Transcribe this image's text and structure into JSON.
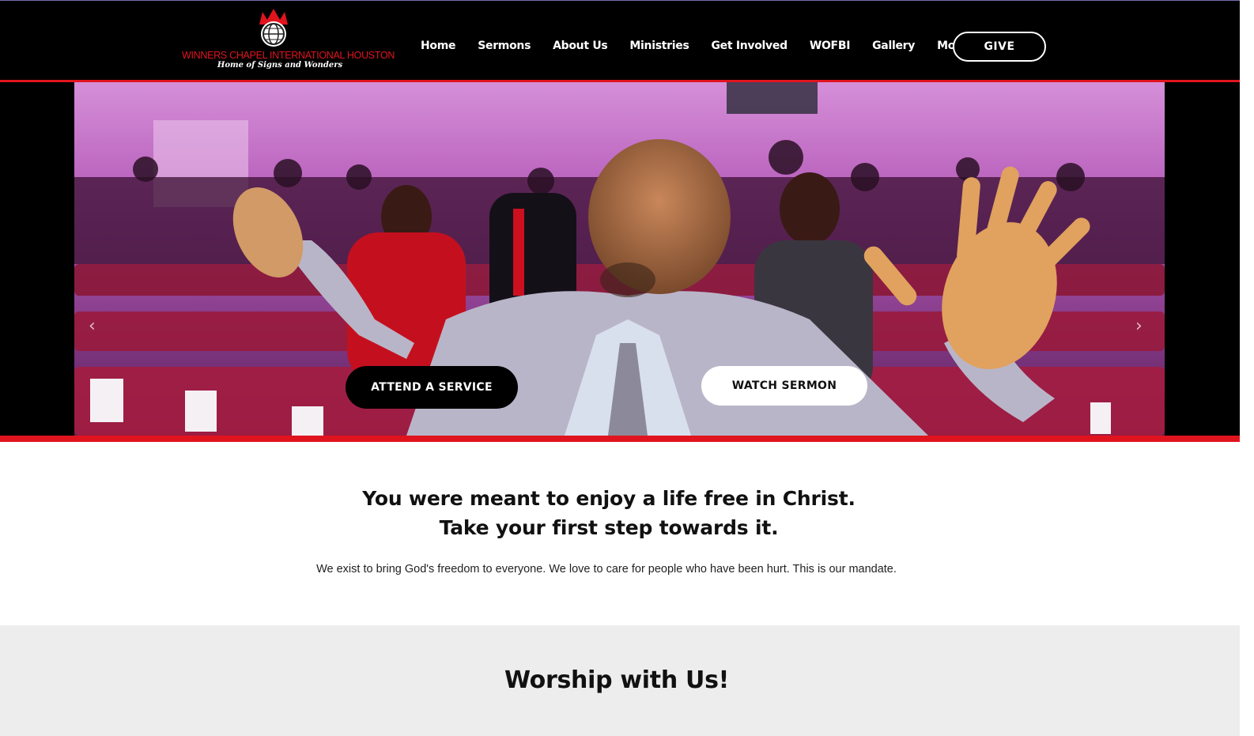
{
  "header": {
    "logo": {
      "name": "WINNERS CHAPEL INTERNATIONAL HOUSTON",
      "tagline": "Home of Signs and Wonders"
    },
    "nav": [
      "Home",
      "Sermons",
      "About Us",
      "Ministries",
      "Get Involved",
      "WOFBI",
      "Gallery",
      "More"
    ],
    "give_label": "GIVE"
  },
  "hero": {
    "attend_label": "ATTEND A SERVICE",
    "watch_label": "WATCH SERMON"
  },
  "intro": {
    "headline_line1": "You were meant to enjoy a life free in Christ.",
    "headline_line2": "Take your first step towards it.",
    "body": "We exist to bring God's freedom to everyone. We love to care for people who have been hurt. This is our mandate."
  },
  "worship": {
    "title": "Worship with Us!"
  },
  "colors": {
    "brand_red": "#e0141e",
    "header_bg": "#000000",
    "worship_bg": "#ededed"
  },
  "icons": [
    "crown-globe-emblem-icon",
    "chevron-left-icon",
    "chevron-right-icon"
  ]
}
